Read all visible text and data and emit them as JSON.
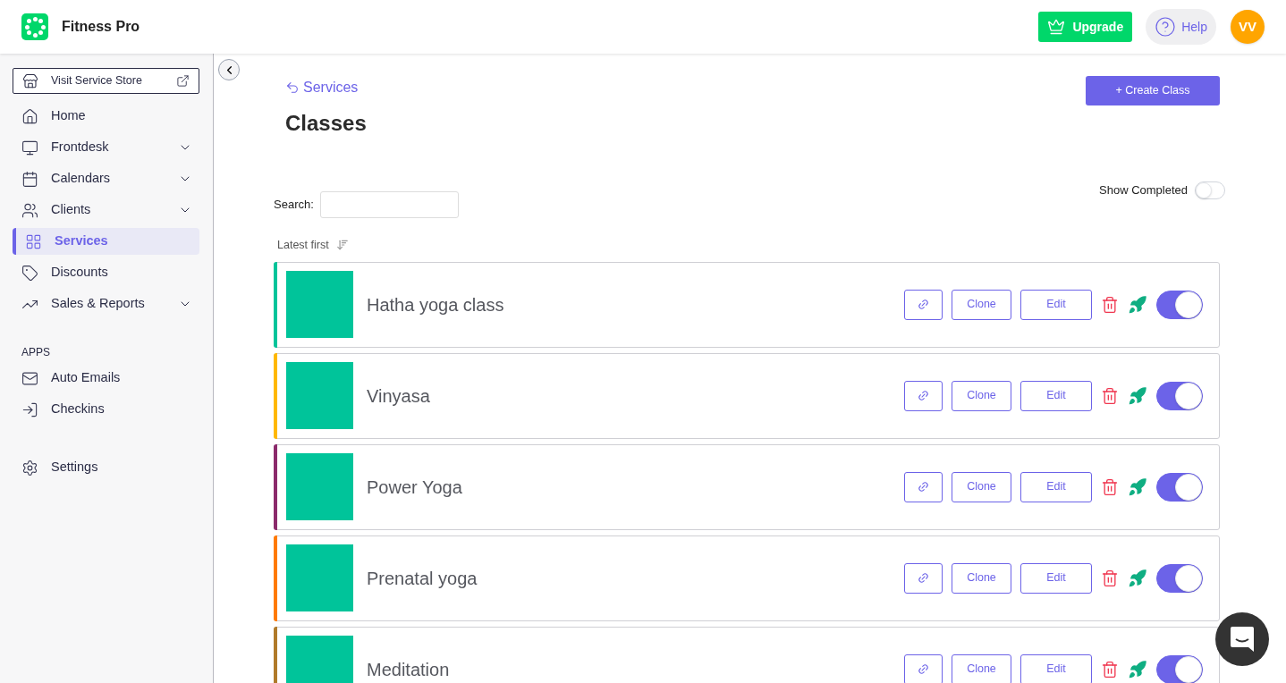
{
  "header": {
    "app_name": "Fitness Pro",
    "upgrade_label": "Upgrade",
    "help_label": "Help",
    "avatar_initials": "VV"
  },
  "sidebar": {
    "store_button": "Visit Service Store",
    "items": [
      {
        "label": "Home",
        "expandable": false,
        "selected": false
      },
      {
        "label": "Frontdesk",
        "expandable": true,
        "selected": false
      },
      {
        "label": "Calendars",
        "expandable": true,
        "selected": false
      },
      {
        "label": "Clients",
        "expandable": true,
        "selected": false
      },
      {
        "label": "Services",
        "expandable": false,
        "selected": true
      },
      {
        "label": "Discounts",
        "expandable": false,
        "selected": false
      },
      {
        "label": "Sales & Reports",
        "expandable": true,
        "selected": false
      }
    ],
    "apps_heading": "APPS",
    "app_items": [
      {
        "label": "Auto Emails",
        "selected": false
      },
      {
        "label": "Checkins",
        "selected": false
      }
    ],
    "settings": {
      "label": "Settings",
      "selected": false
    }
  },
  "page": {
    "back_link": "Services",
    "title": "Classes",
    "create_button": "+ Create Class",
    "search_label": "Search:",
    "show_completed": {
      "label": "Show Completed",
      "on": false
    },
    "sort_label": "Latest first"
  },
  "classes": [
    {
      "name": "Hatha yoga class",
      "color": "#00c49a",
      "on": true,
      "clone_label": "Clone",
      "edit_label": "Edit"
    },
    {
      "name": "Vinyasa",
      "color": "#ffb800",
      "on": true,
      "clone_label": "Clone",
      "edit_label": "Edit"
    },
    {
      "name": "Power Yoga",
      "color": "#8b2a6b",
      "on": true,
      "clone_label": "Clone",
      "edit_label": "Edit"
    },
    {
      "name": "Prenatal yoga",
      "color": "#ff7a00",
      "on": true,
      "clone_label": "Clone",
      "edit_label": "Edit"
    },
    {
      "name": "Meditation",
      "color": "#b07a2a",
      "on": true,
      "clone_label": "Clone",
      "edit_label": "Edit"
    }
  ]
}
